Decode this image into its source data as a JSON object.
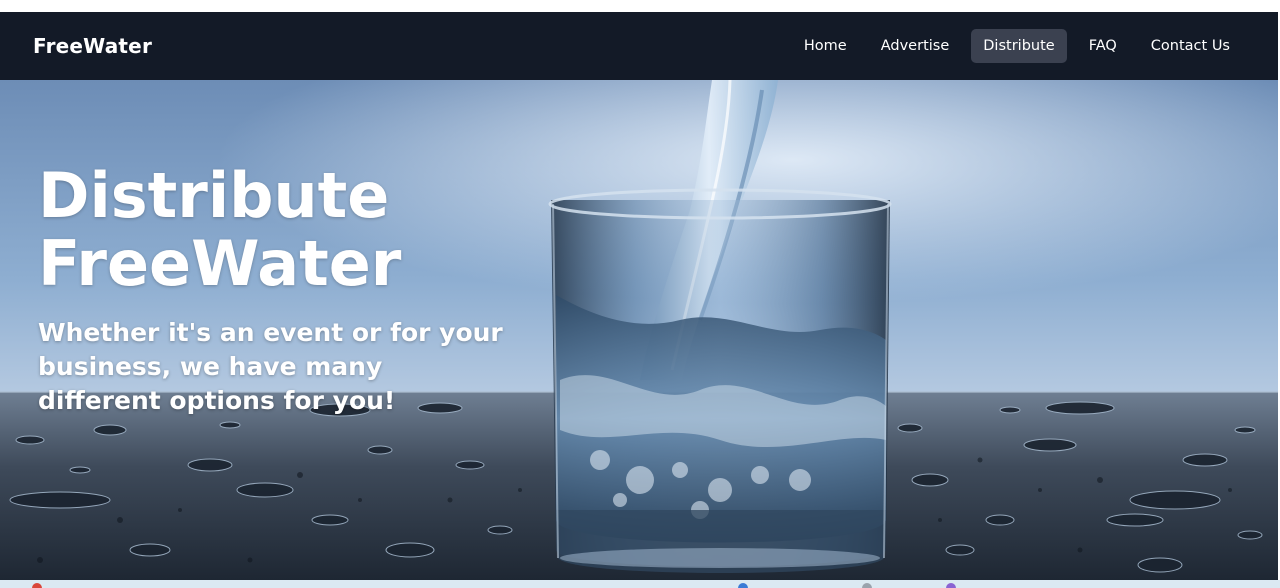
{
  "nav": {
    "brand": "FreeWater",
    "links": [
      {
        "label": "Home",
        "active": false
      },
      {
        "label": "Advertise",
        "active": false
      },
      {
        "label": "Distribute",
        "active": true
      },
      {
        "label": "FAQ",
        "active": false
      },
      {
        "label": "Contact Us",
        "active": false
      }
    ]
  },
  "hero": {
    "title_line1": "Distribute",
    "title_line2": "FreeWater",
    "subtitle": "Whether it's an event or for your business, we have many different options for you!",
    "image": "water-glass-photo"
  },
  "colors": {
    "navbar_bg": "#131a27",
    "active_link_bg": "#3b4150",
    "text": "#ffffff"
  }
}
